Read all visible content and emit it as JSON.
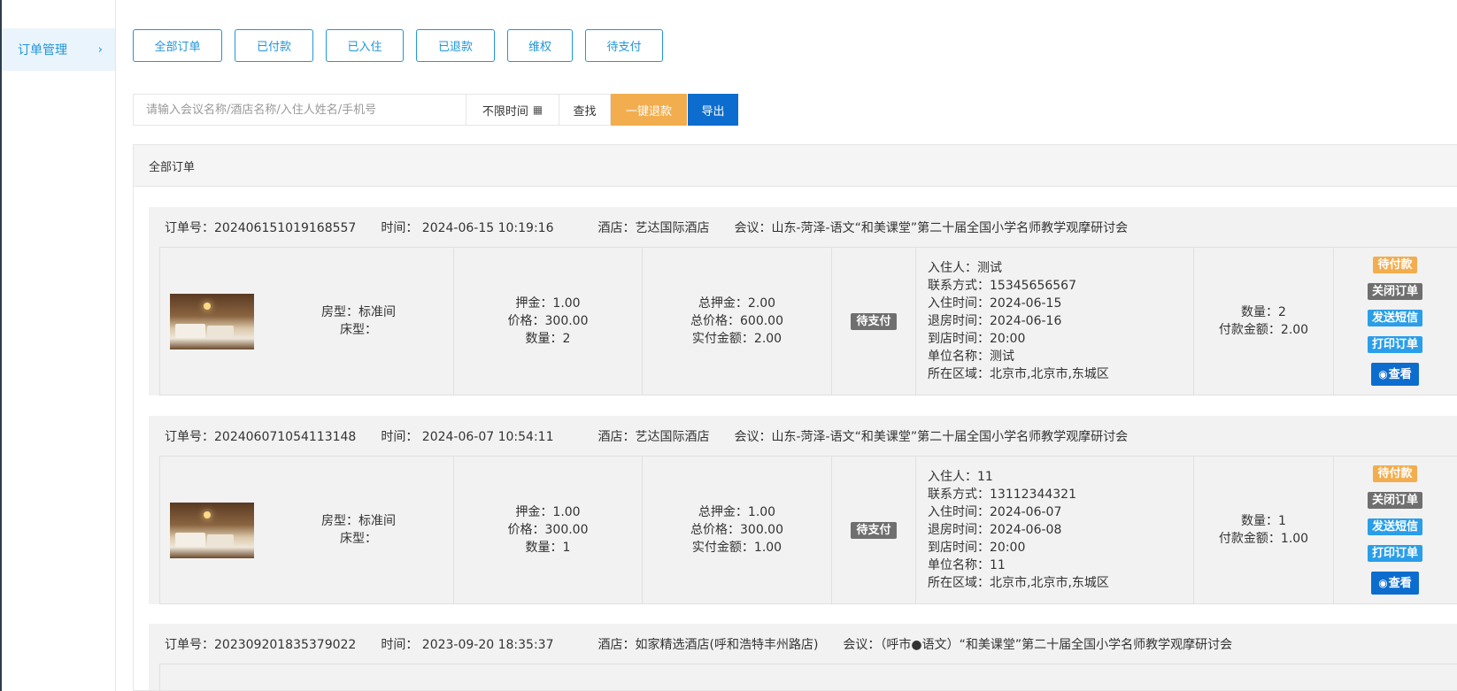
{
  "sidebar": {
    "items": [
      {
        "label": "订单管理",
        "chevron": "›"
      }
    ]
  },
  "tabs": [
    {
      "label": "全部订单"
    },
    {
      "label": "已付款"
    },
    {
      "label": "已入住"
    },
    {
      "label": "已退款"
    },
    {
      "label": "维权"
    },
    {
      "label": "待支付"
    }
  ],
  "search": {
    "placeholder": "请输入会议名称/酒店名称/入住人姓名/手机号",
    "time_label": "不限时间",
    "find_label": "查找",
    "refund_label": "一键退款",
    "export_label": "导出"
  },
  "panel": {
    "title": "全部订单"
  },
  "orders": [
    {
      "order_no": "订单号：202406151019168557",
      "time": "时间：  2024-06-15 10:19:16",
      "hotel": "酒店：艺达国际酒店",
      "meeting": "会议：山东-菏泽-语文“和美课堂”第二十届全国小学名师教学观摩研讨会",
      "room_type": "房型：标准间",
      "bed_type": "床型：",
      "deposit": "押金：1.00",
      "price": "价格：300.00",
      "count": "数量：2",
      "total_deposit": "总押金：2.00",
      "total_price": "总价格：600.00",
      "paid": "实付金额：2.00",
      "status": "待支付",
      "guest": "入住人：测试",
      "contact": "联系方式：15345656567",
      "checkin": "入住时间：2024-06-15",
      "checkout": "退房时间：2024-06-16",
      "arrive": "到店时间：20:00",
      "company": "单位名称：测试",
      "region": "所在区域：北京市,北京市,东城区",
      "qty": "数量：2",
      "pay_amount": "付款金额：2.00",
      "actions": {
        "pending": "待付款",
        "close": "关闭订单",
        "sms": "发送短信",
        "print": "打印订单",
        "view": "查看"
      }
    },
    {
      "order_no": "订单号：202406071054113148",
      "time": "时间：  2024-06-07 10:54:11",
      "hotel": "酒店：艺达国际酒店",
      "meeting": "会议：山东-菏泽-语文“和美课堂”第二十届全国小学名师教学观摩研讨会",
      "room_type": "房型：标准间",
      "bed_type": "床型：",
      "deposit": "押金：1.00",
      "price": "价格：300.00",
      "count": "数量：1",
      "total_deposit": "总押金：1.00",
      "total_price": "总价格：300.00",
      "paid": "实付金额：1.00",
      "status": "待支付",
      "guest": "入住人：11",
      "contact": "联系方式：13112344321",
      "checkin": "入住时间：2024-06-07",
      "checkout": "退房时间：2024-06-08",
      "arrive": "到店时间：20:00",
      "company": "单位名称：11",
      "region": "所在区域：北京市,北京市,东城区",
      "qty": "数量：1",
      "pay_amount": "付款金额：1.00",
      "actions": {
        "pending": "待付款",
        "close": "关闭订单",
        "sms": "发送短信",
        "print": "打印订单",
        "view": "查看"
      }
    },
    {
      "order_no": "订单号：202309201835379022",
      "time": "时间：  2023-09-20 18:35:37",
      "hotel": "酒店：如家精选酒店(呼和浩特丰州路店)",
      "meeting": "会议：（呼市●语文）“和美课堂”第二十届全国小学名师教学观摩研讨会"
    }
  ],
  "colors": {
    "accent": "#2196d9",
    "refund": "#f2ad4e",
    "export": "#0d6dce",
    "status_gray": "#6f6f6f",
    "sms_blue": "#2a9ee8"
  }
}
